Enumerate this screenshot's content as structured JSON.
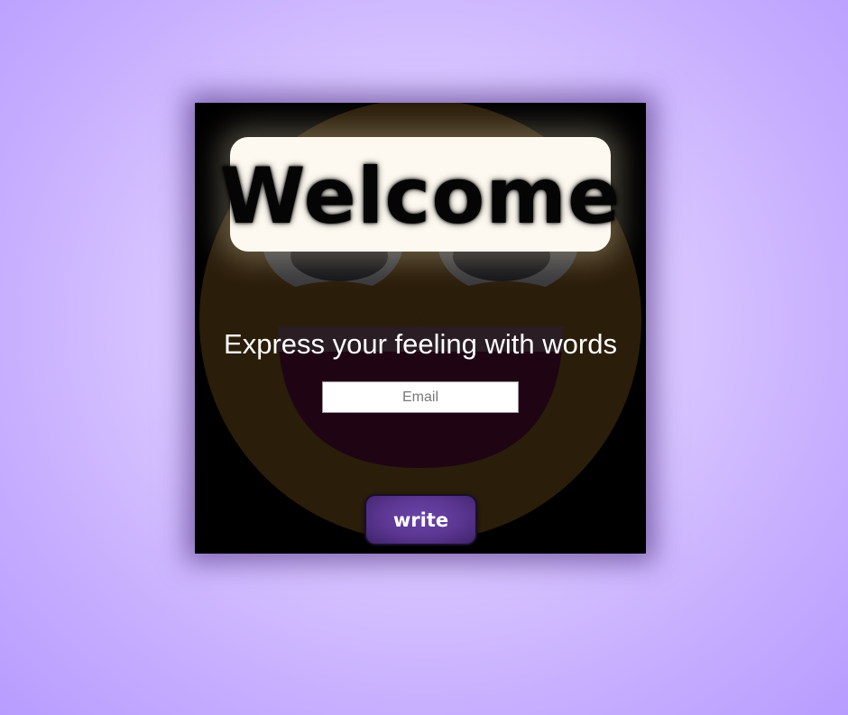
{
  "card": {
    "title": "Welcome",
    "tagline": "Express your feeling with words"
  },
  "form": {
    "email_placeholder": "Email",
    "email_value": "",
    "submit_label": "write"
  },
  "colors": {
    "background": "#d8c6ff",
    "card": "#000000",
    "button": "#5a3590",
    "smiley_face": "#2a1d0a",
    "smiley_mouth": "#1f0414"
  },
  "icons": {
    "background_art": "smiley-face-icon"
  }
}
